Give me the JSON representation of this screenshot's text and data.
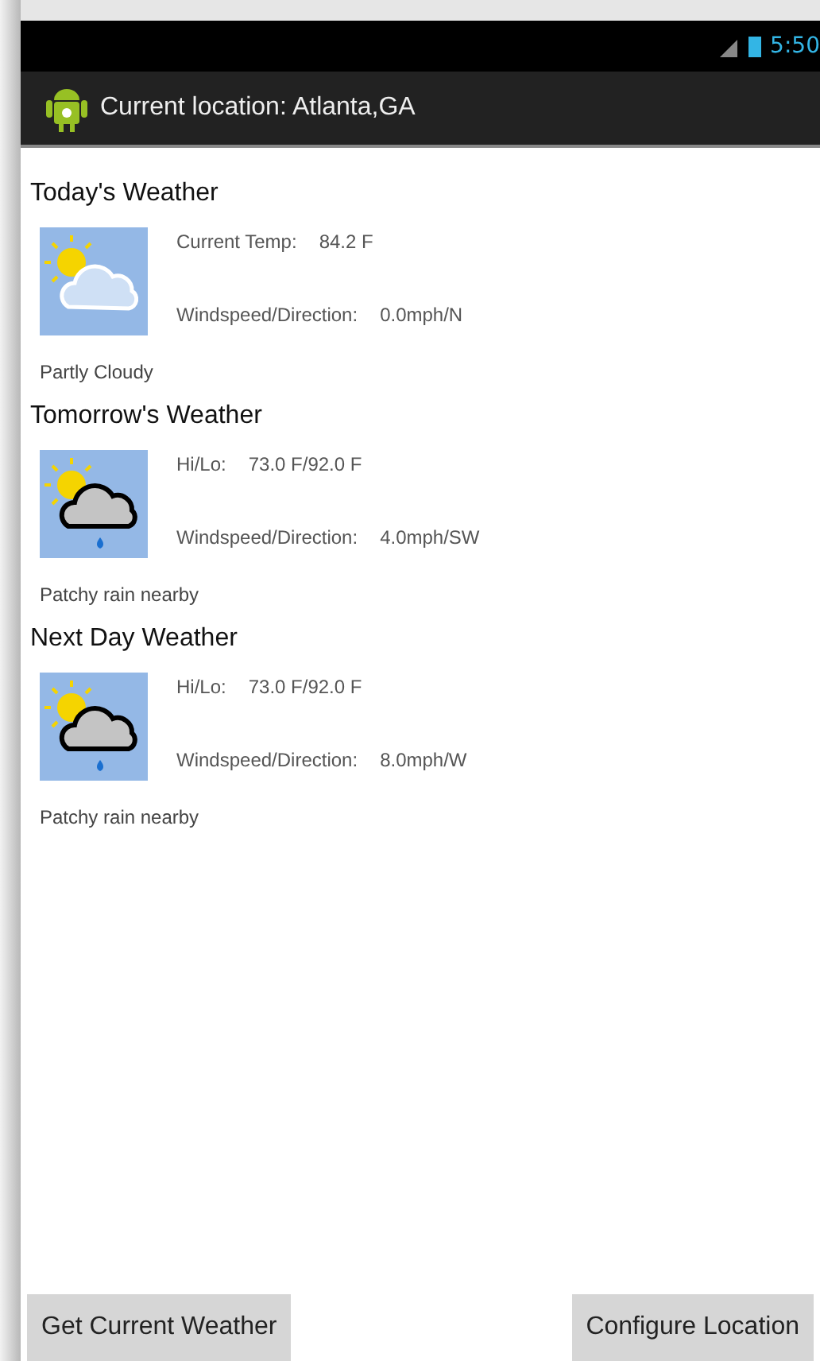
{
  "status_bar": {
    "time": "5:50"
  },
  "action_bar": {
    "title": "Current location: Atlanta,GA"
  },
  "sections": [
    {
      "heading": "Today's Weather",
      "kind": "partly-cloudy",
      "line_1_label": "Current Temp:",
      "line_1_value": "84.2 F",
      "line_2_label": "Windspeed/Direction:",
      "line_2_value": "0.0mph/N",
      "condition": "Partly Cloudy"
    },
    {
      "heading": "Tomorrow's Weather",
      "kind": "rain",
      "line_1_label": "Hi/Lo:",
      "line_1_value": "73.0 F/92.0 F",
      "line_2_label": "Windspeed/Direction:",
      "line_2_value": "4.0mph/SW",
      "condition": "Patchy rain nearby"
    },
    {
      "heading": "Next Day Weather",
      "kind": "rain",
      "line_1_label": "Hi/Lo:",
      "line_1_value": "73.0 F/92.0 F",
      "line_2_label": "Windspeed/Direction:",
      "line_2_value": "8.0mph/W",
      "condition": "Patchy rain nearby"
    }
  ],
  "buttons": [
    "Get Current Weather",
    "Configure Location"
  ]
}
